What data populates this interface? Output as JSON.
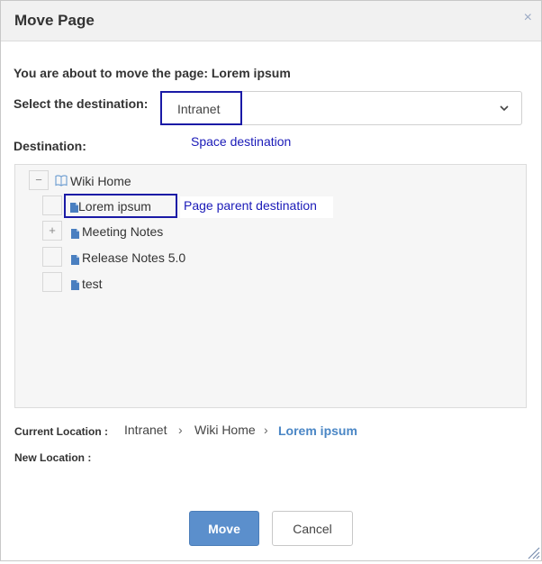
{
  "dialog": {
    "title": "Move Page",
    "close_icon": "close-icon",
    "close_glyph": "×"
  },
  "info": "You are about to move the page: Lorem ipsum",
  "select_destination": {
    "label": "Select the destination:",
    "value": "Intranet",
    "caret_icon": "chevron-down-icon"
  },
  "annotations": {
    "space": "Space destination",
    "parent": "Page parent destination"
  },
  "destination_label": "Destination:",
  "tree": {
    "root": {
      "label": "Wiki Home",
      "toggle": "−",
      "icon": "book-icon"
    },
    "children": [
      {
        "label": "Lorem ipsum",
        "toggle": "",
        "icon": "page-icon",
        "selected": true
      },
      {
        "label": "Meeting Notes",
        "toggle": "+",
        "icon": "page-icon"
      },
      {
        "label": "Release Notes 5.0",
        "toggle": "",
        "icon": "page-icon"
      },
      {
        "label": "test",
        "toggle": "",
        "icon": "page-icon"
      }
    ]
  },
  "current_location": {
    "label": "Current Location :",
    "crumbs": [
      "Intranet",
      "Wiki Home"
    ],
    "separator": "›",
    "current": "Lorem ipsum"
  },
  "new_location": {
    "label": "New Location :"
  },
  "buttons": {
    "move": "Move",
    "cancel": "Cancel"
  },
  "colors": {
    "primary_button": "#5b8fcc",
    "annotation": "#1a1ab8",
    "highlight_border": "#1a1aa6",
    "current_location": "#4a86c5"
  }
}
